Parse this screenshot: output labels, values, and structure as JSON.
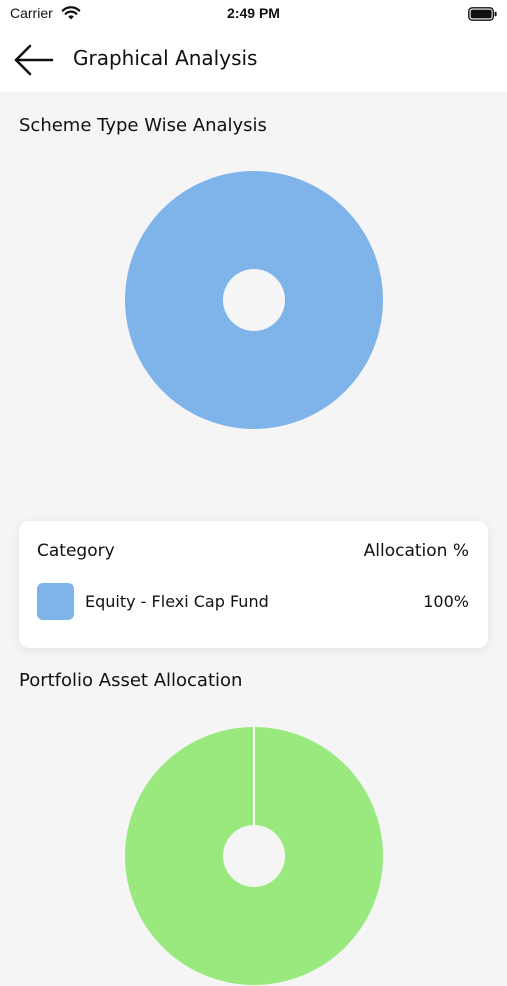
{
  "status_bar": {
    "carrier": "Carrier",
    "time": "2:49 PM",
    "wifi_icon": "wifi-icon",
    "battery_icon": "battery-icon"
  },
  "header": {
    "title": "Graphical Analysis",
    "back_icon": "arrow-left-icon"
  },
  "scheme_section": {
    "title": "Scheme Type Wise Analysis"
  },
  "legend": {
    "header_category": "Category",
    "header_allocation": "Allocation %",
    "items": [
      {
        "label": "Equity - Flexi Cap Fund",
        "value": "100%",
        "color": "#7fb4ea"
      }
    ]
  },
  "asset_section": {
    "title": "Portfolio Asset Allocation"
  },
  "colors": {
    "scheme_donut": "#7fb4ea",
    "asset_donut": "#99e97f",
    "background": "#f5f5f5"
  },
  "chart_data": [
    {
      "type": "pie",
      "title": "Scheme Type Wise Analysis",
      "categories": [
        "Equity - Flexi Cap Fund"
      ],
      "values": [
        100
      ],
      "colors": [
        "#7fb4ea"
      ]
    },
    {
      "type": "pie",
      "title": "Portfolio Asset Allocation",
      "categories": [],
      "values": [
        100
      ],
      "colors": [
        "#99e97f"
      ]
    }
  ]
}
